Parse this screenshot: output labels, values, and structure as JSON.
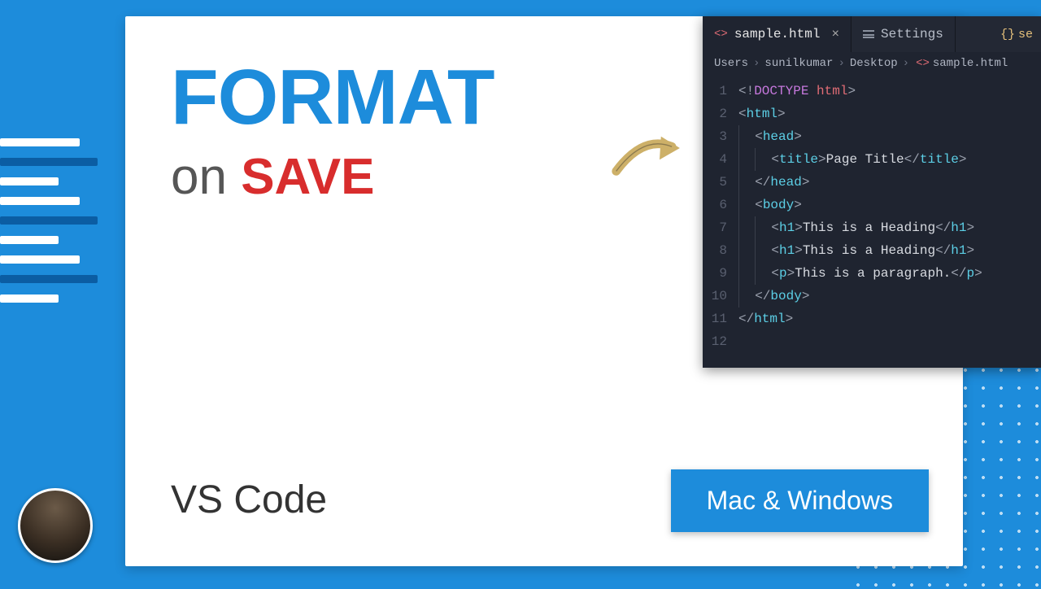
{
  "heading": {
    "word1": "FORMAT",
    "word2a": "on",
    "word2b": "SAVE"
  },
  "product_label": "VS Code",
  "platform_label": "Mac & Windows",
  "editor": {
    "tabs": [
      {
        "label": "sample.html",
        "active": true
      },
      {
        "label": "Settings",
        "active": false
      }
    ],
    "overflow_label": "se",
    "breadcrumb": [
      "Users",
      "sunilkumar",
      "Desktop",
      "sample.html"
    ],
    "lines": [
      {
        "n": 1,
        "indent": 0,
        "html": "<span class='t-punc'>&lt;!</span><span class='t-doctype'>DOCTYPE</span> <span class='t-keyword'>html</span><span class='t-punc'>&gt;</span>"
      },
      {
        "n": 2,
        "indent": 0,
        "html": "<span class='t-punc'>&lt;</span><span class='t-tag'>html</span><span class='t-punc'>&gt;</span>"
      },
      {
        "n": 3,
        "indent": 1,
        "html": "<span class='t-punc'>&lt;</span><span class='t-tag'>head</span><span class='t-punc'>&gt;</span>"
      },
      {
        "n": 4,
        "indent": 2,
        "html": "<span class='t-punc'>&lt;</span><span class='t-tag'>title</span><span class='t-punc'>&gt;</span><span class='t-text'>Page Title</span><span class='t-punc'>&lt;/</span><span class='t-tag'>title</span><span class='t-punc'>&gt;</span>"
      },
      {
        "n": 5,
        "indent": 1,
        "html": "<span class='t-punc'>&lt;/</span><span class='t-tag'>head</span><span class='t-punc'>&gt;</span>"
      },
      {
        "n": 6,
        "indent": 1,
        "html": "<span class='t-punc'>&lt;</span><span class='t-tag'>body</span><span class='t-punc'>&gt;</span>"
      },
      {
        "n": 7,
        "indent": 2,
        "html": "<span class='t-punc'>&lt;</span><span class='t-tag'>h1</span><span class='t-punc'>&gt;</span><span class='t-text'>This is a Heading</span><span class='t-punc'>&lt;/</span><span class='t-tag'>h1</span><span class='t-punc'>&gt;</span>"
      },
      {
        "n": 8,
        "indent": 2,
        "html": "<span class='t-punc'>&lt;</span><span class='t-tag'>h1</span><span class='t-punc'>&gt;</span><span class='t-text'>This is a Heading</span><span class='t-punc'>&lt;/</span><span class='t-tag'>h1</span><span class='t-punc'>&gt;</span>"
      },
      {
        "n": 9,
        "indent": 2,
        "html": "<span class='t-punc'>&lt;</span><span class='t-tag'>p</span><span class='t-punc'>&gt;</span><span class='t-text'>This is a paragraph.</span><span class='t-punc'>&lt;/</span><span class='t-tag'>p</span><span class='t-punc'>&gt;</span>"
      },
      {
        "n": 10,
        "indent": 1,
        "html": "<span class='t-punc'>&lt;/</span><span class='t-tag'>body</span><span class='t-punc'>&gt;</span>"
      },
      {
        "n": 11,
        "indent": 0,
        "html": "<span class='t-punc'>&lt;/</span><span class='t-tag'>html</span><span class='t-punc'>&gt;</span>"
      },
      {
        "n": 12,
        "indent": 0,
        "html": ""
      }
    ]
  }
}
